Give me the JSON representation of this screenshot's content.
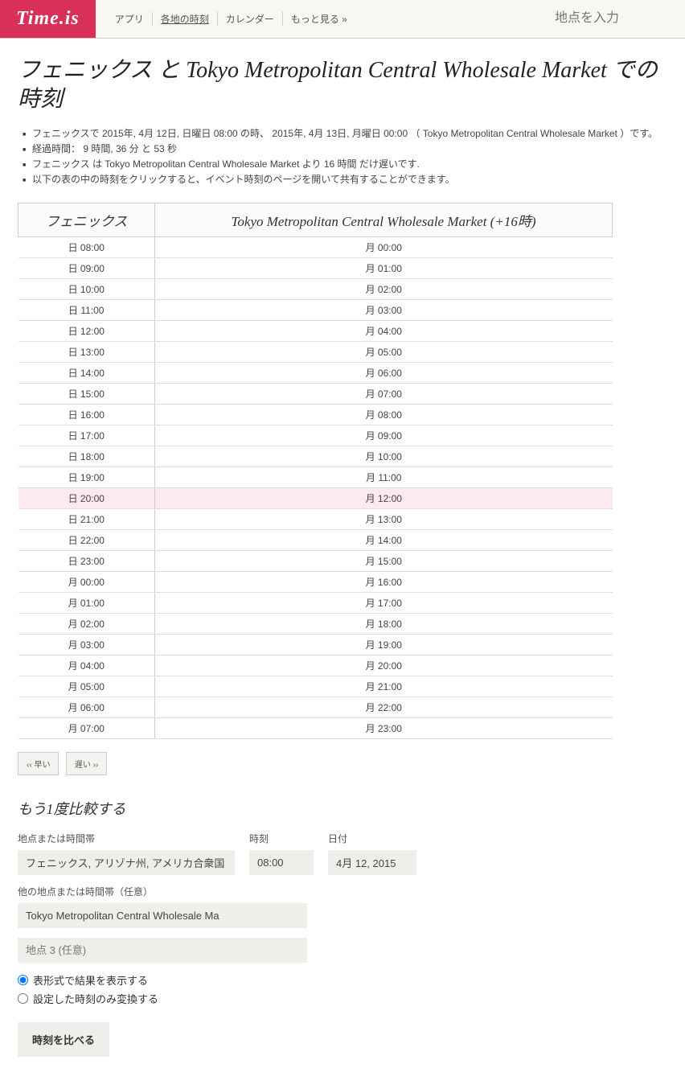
{
  "header": {
    "logo": "Time.is",
    "nav": [
      "アプリ",
      "各地の時刻",
      "カレンダー",
      "もっと見る »"
    ],
    "nav_current": 1,
    "search_placeholder": "地点を入力"
  },
  "title": "フェニックス と Tokyo Metropolitan Central Wholesale Market での時刻",
  "facts": [
    "フェニックスで 2015年, 4月 12日, 日曜日 08:00 の時、 2015年, 4月 13日, 月曜日 00:00 （ Tokyo Metropolitan Central Wholesale Market ）です。",
    "経過時間： 9 時間, 36 分 と 53 秒",
    "フェニックス は Tokyo Metropolitan Central Wholesale Market より 16 時間 だけ遅いです.",
    "以下の表の中の時刻をクリックすると、イベント時刻のページを開いて共有することができます。"
  ],
  "table": {
    "col1": "フェニックス",
    "col2": "Tokyo Metropolitan Central Wholesale Market (+16時)",
    "rows": [
      {
        "a": "日 08:00",
        "b": "月 00:00"
      },
      {
        "a": "日 09:00",
        "b": "月 01:00"
      },
      {
        "a": "日 10:00",
        "b": "月 02:00"
      },
      {
        "a": "日 11:00",
        "b": "月 03:00"
      },
      {
        "a": "日 12:00",
        "b": "月 04:00"
      },
      {
        "a": "日 13:00",
        "b": "月 05:00"
      },
      {
        "a": "日 14:00",
        "b": "月 06:00"
      },
      {
        "a": "日 15:00",
        "b": "月 07:00"
      },
      {
        "a": "日 16:00",
        "b": "月 08:00"
      },
      {
        "a": "日 17:00",
        "b": "月 09:00"
      },
      {
        "a": "日 18:00",
        "b": "月 10:00"
      },
      {
        "a": "日 19:00",
        "b": "月 11:00"
      },
      {
        "a": "日 20:00",
        "b": "月 12:00",
        "hl": true
      },
      {
        "a": "日 21:00",
        "b": "月 13:00"
      },
      {
        "a": "日 22:00",
        "b": "月 14:00"
      },
      {
        "a": "日 23:00",
        "b": "月 15:00"
      },
      {
        "a": "月 00:00",
        "b": "月 16:00",
        "sep": true
      },
      {
        "a": "月 01:00",
        "b": "月 17:00"
      },
      {
        "a": "月 02:00",
        "b": "月 18:00"
      },
      {
        "a": "月 03:00",
        "b": "月 19:00"
      },
      {
        "a": "月 04:00",
        "b": "月 20:00"
      },
      {
        "a": "月 05:00",
        "b": "月 21:00"
      },
      {
        "a": "月 06:00",
        "b": "月 22:00"
      },
      {
        "a": "月 07:00",
        "b": "月 23:00"
      }
    ]
  },
  "pager": {
    "prev": "‹‹ 早い",
    "next": "遅い ››"
  },
  "form": {
    "heading": "もう1度比較する",
    "loc_label": "地点または時間帯",
    "loc_value": "フェニックス, アリゾナ州, アメリカ合衆国",
    "time_label": "時刻",
    "time_value": "08:00",
    "date_label": "日付",
    "date_value": "4月 12, 2015",
    "loc2_label": "他の地点または時間帯（任意）",
    "loc2_value": "Tokyo Metropolitan Central Wholesale Ma",
    "loc3_placeholder": "地点 3 (任意)",
    "radio_table": "表形式で結果を表示する",
    "radio_convert": "設定した時刻のみ変換する",
    "submit": "時刻を比べる"
  }
}
